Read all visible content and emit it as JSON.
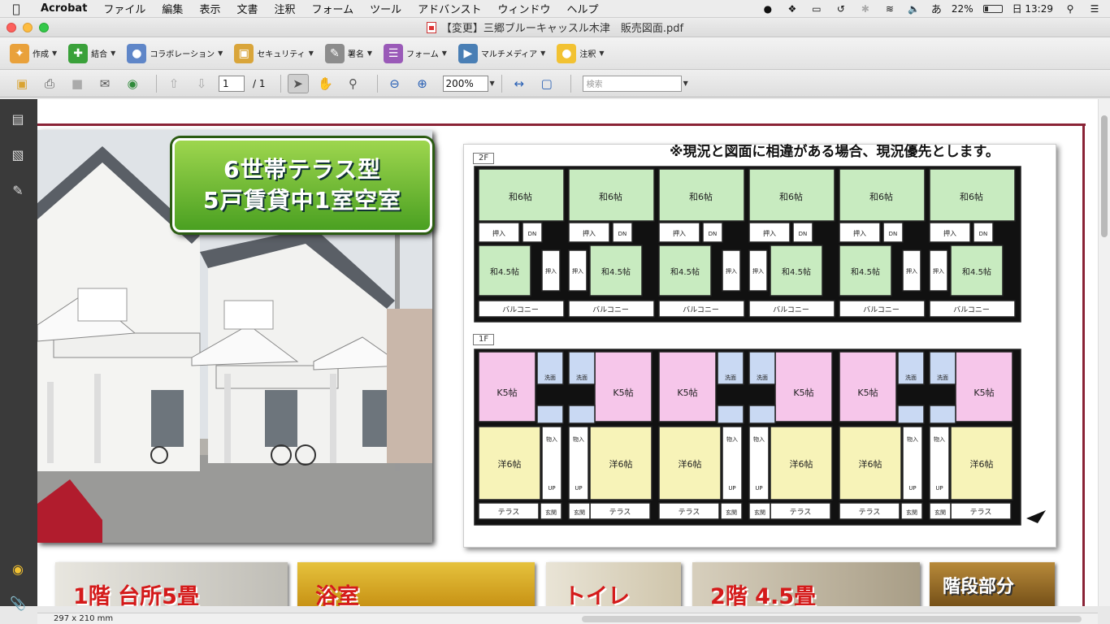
{
  "menubar": {
    "app": "Acrobat",
    "items": [
      "ファイル",
      "編集",
      "表示",
      "文書",
      "注釈",
      "フォーム",
      "ツール",
      "アドバンスト",
      "ウィンドウ",
      "ヘルプ"
    ],
    "ime": "あ",
    "battery": "22%",
    "clock": "日 13:29"
  },
  "window": {
    "title": "【変更】三郷ブルーキャッスル木津　販売図面.pdf"
  },
  "toolbar1": {
    "create": "作成",
    "combine": "結合",
    "collaboration": "コラボレーション",
    "security": "セキュリティ",
    "sign": "署名",
    "forms": "フォーム",
    "multimedia": "マルチメディア",
    "comment": "注釈"
  },
  "toolbar2": {
    "page_current": "1",
    "page_total": "/ 1",
    "zoom": "200%",
    "search_placeholder": "検索"
  },
  "document": {
    "banner_line1": "6世帯テラス型",
    "banner_line2": "5戸賃貸中1室空室",
    "notice": "※現況と図面に相違がある場合、現況優先とします。",
    "floor2": "2F",
    "floor1": "1F",
    "room_wa6": "和6帖",
    "room_wa45": "和4.5帖",
    "room_oshiire": "押入",
    "room_balcony": "バルコニー",
    "room_dn": "DN",
    "room_k5": "K5帖",
    "room_you6": "洋6帖",
    "room_terrace": "テラス",
    "room_genkan": "玄関",
    "room_up": "UP",
    "room_monoire": "物入",
    "room_wash": "洗面",
    "thumbs": [
      "1階 台所5畳",
      "浴室",
      "トイレ",
      "2階 4.5畳",
      "階段部分"
    ]
  },
  "statusbar": {
    "page_size": "297 x 210 mm"
  },
  "colors": {
    "frame_red": "#8a2336",
    "banner_green": "#4aa021",
    "room_green": "#c8ebc0",
    "room_pink": "#f6c6ea",
    "room_yellow": "#f7f3b8",
    "room_blue": "#c9d9f3"
  }
}
